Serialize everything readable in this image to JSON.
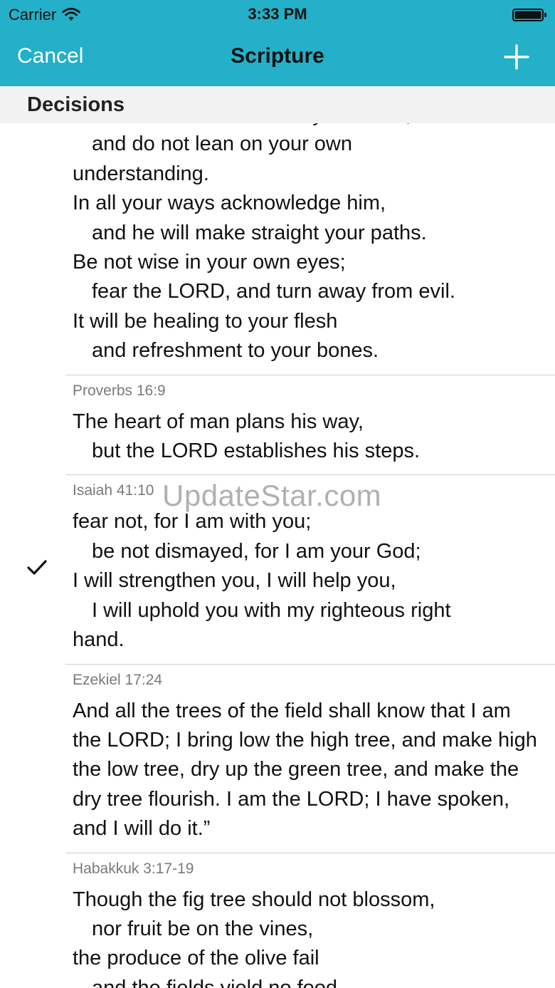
{
  "status_bar": {
    "carrier": "Carrier",
    "time": "3:33 PM"
  },
  "nav": {
    "cancel_label": "Cancel",
    "title": "Scripture"
  },
  "section": {
    "title": "Decisions"
  },
  "watermark": "UpdateStar.com",
  "entries": [
    {
      "reference": "",
      "lines": [
        {
          "text": "Trust in the LORD with all your heart,",
          "indent": false
        },
        {
          "text": "and do not lean on your own",
          "indent": true
        },
        {
          "text": "understanding.",
          "indent": false
        },
        {
          "text": "In all your ways acknowledge him,",
          "indent": false
        },
        {
          "text": "and he will make straight your paths.",
          "indent": true
        },
        {
          "text": "Be not wise in your own eyes;",
          "indent": false
        },
        {
          "text": "fear the LORD, and turn away from evil.",
          "indent": true
        },
        {
          "text": "It will be healing to your flesh",
          "indent": false
        },
        {
          "text": "and refreshment to your bones.",
          "indent": true
        }
      ],
      "checked": false
    },
    {
      "reference": "Proverbs 16:9",
      "lines": [
        {
          "text": "The heart of man plans his way,",
          "indent": false
        },
        {
          "text": "but the LORD establishes his steps.",
          "indent": true
        }
      ],
      "checked": false
    },
    {
      "reference": "Isaiah 41:10",
      "lines": [
        {
          "text": "fear not, for I am with you;",
          "indent": false
        },
        {
          "text": "be not dismayed, for I am your God;",
          "indent": true
        },
        {
          "text": "I will strengthen you, I will help you,",
          "indent": false
        },
        {
          "text": "I will uphold you with my righteous right",
          "indent": true
        },
        {
          "text": "hand.",
          "indent": false
        }
      ],
      "checked": true
    },
    {
      "reference": "Ezekiel 17:24",
      "paragraph": "And all the trees of the field shall know that I am the LORD; I bring low the high tree, and make high the low tree, dry up the green tree, and make the dry tree flourish. I am the LORD; I have spoken, and I will do it.”",
      "checked": false
    },
    {
      "reference": "Habakkuk 3:17-19",
      "lines": [
        {
          "text": "Though the fig tree should not blossom,",
          "indent": false
        },
        {
          "text": "nor fruit be on the vines,",
          "indent": true
        },
        {
          "text": "the produce of the olive fail",
          "indent": false
        },
        {
          "text": "and the fields yield no food,",
          "indent": true
        }
      ],
      "checked": false
    }
  ],
  "colors": {
    "accent": "#23b0c8",
    "section_bg": "#f2f2f2"
  }
}
